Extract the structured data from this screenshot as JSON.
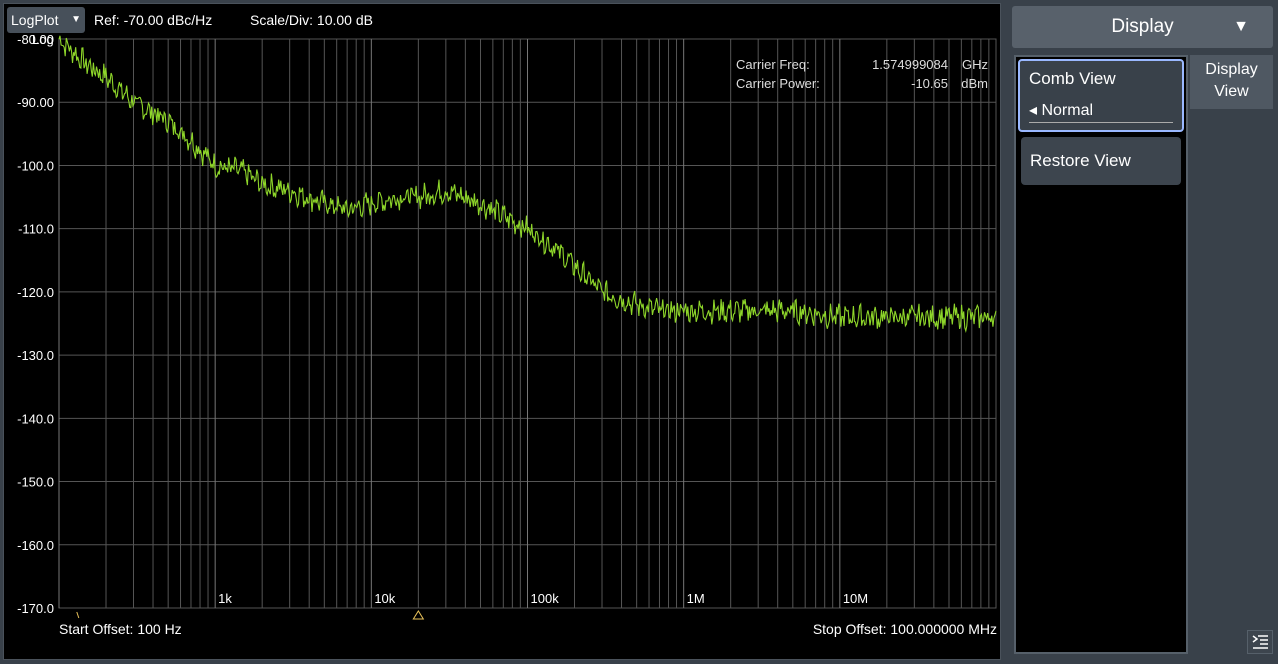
{
  "top_bar": {
    "mode_label": "LogPlot",
    "ref_text": "Ref: -70.00 dBc/Hz",
    "scale_text": "Scale/Div: 10.00 dB"
  },
  "chart_data": {
    "type": "line",
    "x_scale": "log",
    "y_scale_label": "Log",
    "xlim": [
      100,
      100000000
    ],
    "ylim": [
      -170,
      -80
    ],
    "y_ticks": [
      "-80.00",
      "-90.00",
      "-100.0",
      "-110.0",
      "-120.0",
      "-130.0",
      "-140.0",
      "-150.0",
      "-160.0",
      "-170.0"
    ],
    "x_tick_labels": [
      {
        "label": "1k",
        "value": 1000
      },
      {
        "label": "10k",
        "value": 10000
      },
      {
        "label": "100k",
        "value": 100000
      },
      {
        "label": "1M",
        "value": 1000000
      },
      {
        "label": "10M",
        "value": 10000000
      }
    ],
    "grid": true,
    "series": [
      {
        "color": "#8ed62a",
        "x": [
          100,
          150,
          200,
          300,
          500,
          700,
          1000,
          1500,
          2000,
          3000,
          5000,
          7000,
          10000,
          15000,
          20000,
          30000,
          50000,
          70000,
          100000,
          150000,
          200000,
          300000,
          500000,
          700000,
          1000000,
          2000000,
          5000000,
          10000000,
          20000000,
          50000000,
          100000000
        ],
        "y": [
          -80,
          -84,
          -86,
          -90,
          -93,
          -96,
          -100,
          -101,
          -103,
          -104,
          -106,
          -107,
          -106,
          -105,
          -105,
          -104,
          -106,
          -108,
          -110,
          -113,
          -116,
          -120,
          -122,
          -123,
          -123,
          -123,
          -123,
          -124,
          -124,
          -124,
          -124
        ]
      }
    ]
  },
  "carrier": {
    "freq_label": "Carrier Freq:",
    "freq_value": "1.574999084",
    "freq_unit": "GHz",
    "power_label": "Carrier Power:",
    "power_value": "-10.65",
    "power_unit": "dBm"
  },
  "footer": {
    "start_offset": "Start Offset: 100 Hz",
    "stop_offset": "Stop Offset: 100.000000 MHz"
  },
  "right_panel": {
    "dropdown_label": "Display",
    "tab_label_line1": "Display",
    "tab_label_line2": "View",
    "comb_view_title": "Comb View",
    "comb_view_value": "◂ Normal",
    "restore_view_label": "Restore View"
  },
  "colors": {
    "trace": "#8ed62a",
    "grid": "#555555",
    "marker": "#e8c25a",
    "accent_border": "#9ab8ff"
  }
}
